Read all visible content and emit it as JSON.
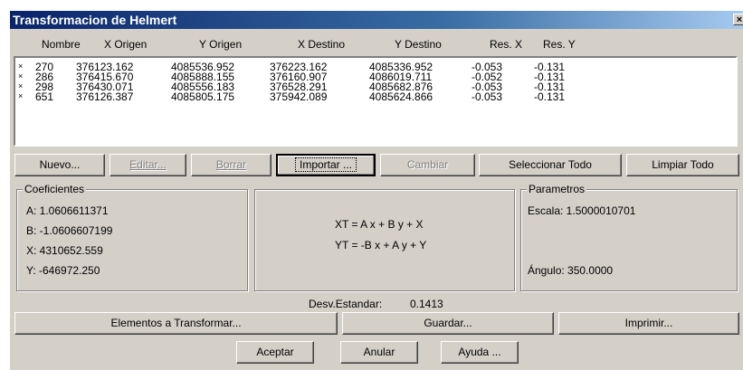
{
  "window": {
    "title": "Transformacion de Helmert",
    "close_label": "×"
  },
  "columns": [
    "Nombre",
    "X Origen",
    "Y Origen",
    "X Destino",
    "Y Destino",
    "Res. X",
    "Res. Y"
  ],
  "rows": [
    {
      "mark": "×",
      "nombre": "270",
      "x_origen": "376123.162",
      "y_origen": "4085536.952",
      "x_destino": "376223.162",
      "y_destino": "4085336.952",
      "res_x": "-0.053",
      "res_y": "-0.131"
    },
    {
      "mark": "×",
      "nombre": "286",
      "x_origen": "376415.670",
      "y_origen": "4085888.155",
      "x_destino": "376160.907",
      "y_destino": "4086019.711",
      "res_x": "-0.052",
      "res_y": "-0.131"
    },
    {
      "mark": "×",
      "nombre": "298",
      "x_origen": "376430.071",
      "y_origen": "4085556.183",
      "x_destino": "376528.291",
      "y_destino": "4085682.876",
      "res_x": "-0.053",
      "res_y": "-0.131"
    },
    {
      "mark": "×",
      "nombre": "651",
      "x_origen": "376126.387",
      "y_origen": "4085805.175",
      "x_destino": "375942.089",
      "y_destino": "4085624.866",
      "res_x": "-0.053",
      "res_y": "-0.131"
    }
  ],
  "buttons": {
    "nuevo": "Nuevo...",
    "editar": "Editar...",
    "borrar": "Borrar",
    "importar": "Importar ...",
    "cambiar": "Cambiar",
    "seleccionar_todo": "Seleccionar Todo",
    "limpiar_todo": "Limpiar Todo",
    "elementos": "Elementos a Transformar...",
    "guardar": "Guardar...",
    "imprimir": "Imprimir...",
    "aceptar": "Aceptar",
    "anular": "Anular",
    "ayuda": "Ayuda ..."
  },
  "coeficientes": {
    "label": "Coeficientes",
    "a": "A: 1.0606611371",
    "b": "B: -1.0606607199",
    "x": "X: 4310652.559",
    "y": "Y: -646972.250"
  },
  "formulas": {
    "xt": "XT = A x + B y + X",
    "yt": "YT = -B x + A y + Y"
  },
  "parametros": {
    "label": "Parametros",
    "escala": "Escala: 1.5000010701",
    "angulo": "Ángulo: 350.0000"
  },
  "desv": {
    "label": "Desv.Estandar:",
    "value": "0.1413"
  }
}
